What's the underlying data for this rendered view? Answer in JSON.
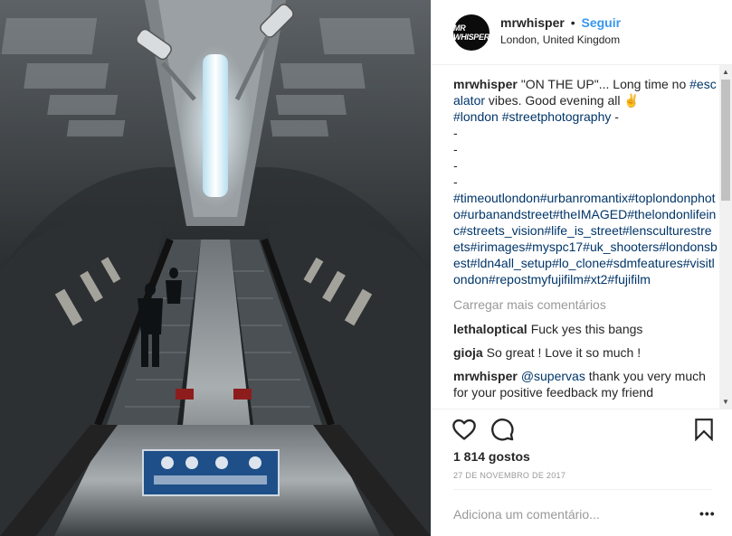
{
  "post": {
    "avatar_text": "MR WHISPER",
    "username": "mrwhisper",
    "separator": "•",
    "follow_label": "Seguir",
    "location": "London, United Kingdom"
  },
  "caption": {
    "username": "mrwhisper",
    "text_1": "\"ON THE UP\"... Long time no ",
    "tag_escalator": "#escalator",
    "text_2": " vibes. Good evening all ✌",
    "tag_london": "#london",
    "tag_streetphotography": "#streetphotography",
    "text_3": " -",
    "dashes": [
      "-",
      "-",
      "-",
      "-"
    ],
    "hashtag_block": "#timeoutlondon#urbanromantix#toplondonphoto#urbanandstreet#theIMAGED#thelondonlifeinc#streets_vision#life_is_street#lensculturestreets#irimages#myspc17#uk_shooters#londonsbest#ldn4all_setup#lo_clone#sdmfeatures#visitlondon#repostmyfujifilm#xt2#fujifilm"
  },
  "load_more": "Carregar mais comentários",
  "comments": [
    {
      "username": "lethaloptical",
      "text": "Fuck yes this bangs"
    },
    {
      "username": "gioja",
      "text": "So great ! Love it so much !"
    },
    {
      "username": "mrwhisper",
      "mention": "@supervas",
      "text": " thank you very much for your positive feedback my friend"
    }
  ],
  "likes_text": "1 814 gostos",
  "date_text": "27 DE NOVEMBRO DE 2017",
  "comment_input_placeholder": "Adiciona um comentário...",
  "more_options_label": "•••",
  "scroll_up_icon": "▲",
  "scroll_down_icon": "▼",
  "icons": {
    "like": "heart-outline-icon",
    "comment": "speech-bubble-icon",
    "save": "bookmark-icon"
  },
  "colors": {
    "link": "#3897f0",
    "hashtag": "#003569",
    "muted": "#999999",
    "text": "#262626"
  }
}
